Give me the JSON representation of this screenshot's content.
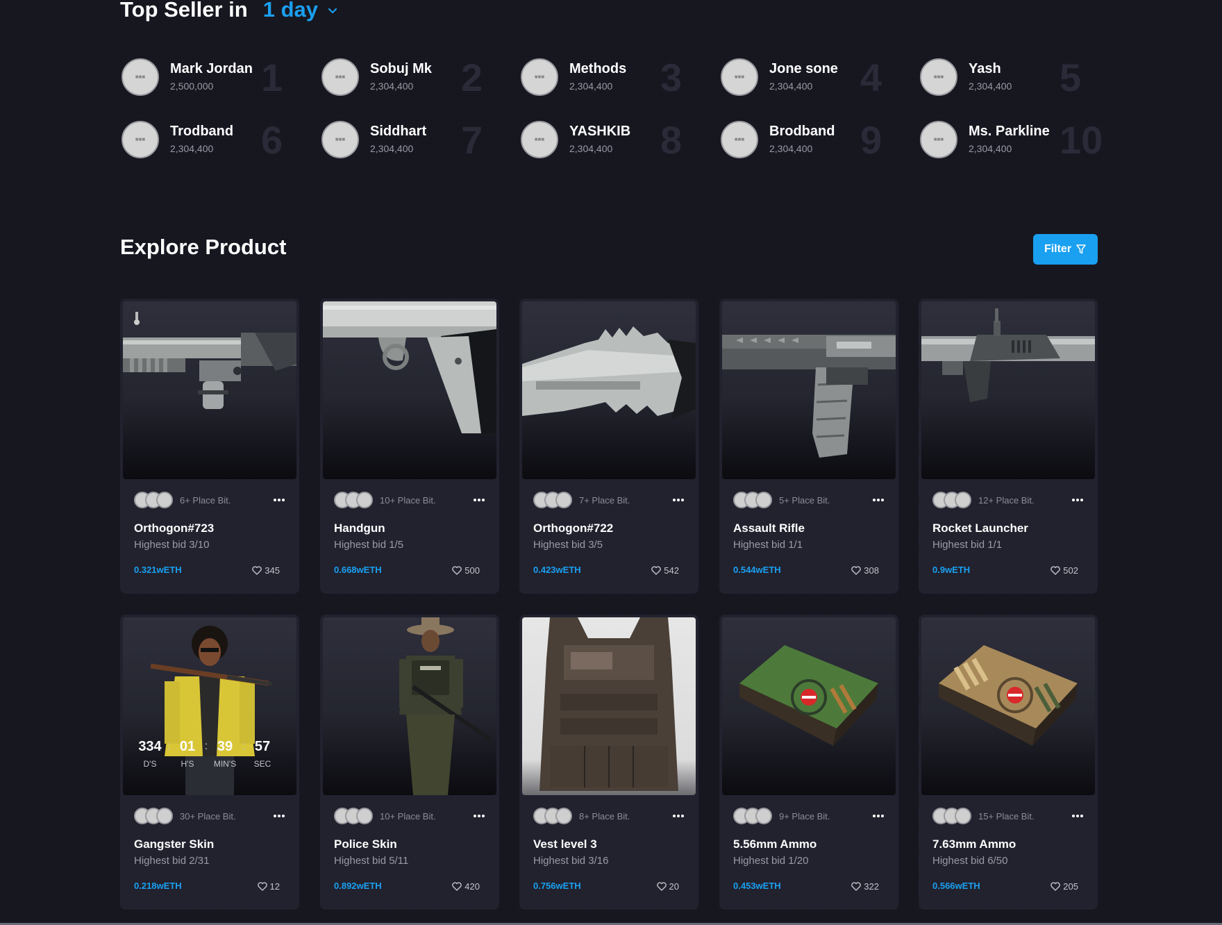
{
  "top_seller": {
    "title": "Top Seller in",
    "period": "1 day",
    "sellers": [
      {
        "name": "Mark Jordan",
        "amount": "2,500,000",
        "rank": "1"
      },
      {
        "name": "Sobuj Mk",
        "amount": "2,304,400",
        "rank": "2"
      },
      {
        "name": "Methods",
        "amount": "2,304,400",
        "rank": "3"
      },
      {
        "name": "Jone sone",
        "amount": "2,304,400",
        "rank": "4"
      },
      {
        "name": "Yash",
        "amount": "2,304,400",
        "rank": "5"
      },
      {
        "name": "Trodband",
        "amount": "2,304,400",
        "rank": "6"
      },
      {
        "name": "Siddhart",
        "amount": "2,304,400",
        "rank": "7"
      },
      {
        "name": "YASHKIB",
        "amount": "2,304,400",
        "rank": "8"
      },
      {
        "name": "Brodband",
        "amount": "2,304,400",
        "rank": "9"
      },
      {
        "name": "Ms. Parkline",
        "amount": "2,304,400",
        "rank": "10"
      }
    ]
  },
  "explore": {
    "title": "Explore Product",
    "filter_label": "Filter",
    "products": [
      {
        "title": "Orthogon#723",
        "bid_place": "6+ Place Bit.",
        "highest_bid": "Highest bid 3/10",
        "price": "0.321wETH",
        "likes": "345",
        "image": "grenade-launcher"
      },
      {
        "title": "Handgun",
        "bid_place": "10+ Place Bit.",
        "highest_bid": "Highest bid 1/5",
        "price": "0.668wETH",
        "likes": "500",
        "image": "handgun"
      },
      {
        "title": "Orthogon#722",
        "bid_place": "7+ Place Bit.",
        "highest_bid": "Highest bid 3/5",
        "price": "0.423wETH",
        "likes": "542",
        "image": "knife"
      },
      {
        "title": "Assault Rifle",
        "bid_place": "5+ Place Bit.",
        "highest_bid": "Highest bid 1/1",
        "price": "0.544wETH",
        "likes": "308",
        "image": "assault-rifle"
      },
      {
        "title": "Rocket Launcher",
        "bid_place": "12+ Place Bit.",
        "highest_bid": "Highest bid 1/1",
        "price": "0.9wETH",
        "likes": "502",
        "image": "rocket-launcher"
      },
      {
        "title": "Gangster Skin",
        "bid_place": "30+ Place Bit.",
        "highest_bid": "Highest bid 2/31",
        "price": "0.218wETH",
        "likes": "12",
        "image": "gangster-skin",
        "countdown": {
          "days": "334",
          "hours": "01",
          "mins": "39",
          "secs": "57",
          "days_label": "D'S",
          "hours_label": "H'S",
          "mins_label": "MIN'S",
          "secs_label": "SEC"
        }
      },
      {
        "title": "Police Skin",
        "bid_place": "10+ Place Bit.",
        "highest_bid": "Highest bid 5/11",
        "price": "0.892wETH",
        "likes": "420",
        "image": "police-skin"
      },
      {
        "title": "Vest level 3",
        "bid_place": "8+ Place Bit.",
        "highest_bid": "Highest bid 3/16",
        "price": "0.756wETH",
        "likes": "20",
        "image": "vest"
      },
      {
        "title": "5.56mm Ammo",
        "bid_place": "9+ Place Bit.",
        "highest_bid": "Highest bid 1/20",
        "price": "0.453wETH",
        "likes": "322",
        "image": "ammo-box-green"
      },
      {
        "title": "7.63mm Ammo",
        "bid_place": "15+ Place Bit.",
        "highest_bid": "Highest bid 6/50",
        "price": "0.566wETH",
        "likes": "205",
        "image": "ammo-box-tan"
      }
    ]
  },
  "colors": {
    "accent": "#1aa0f1",
    "background": "#15151f",
    "card": "#22222f",
    "muted_text": "#9a9aa8"
  }
}
